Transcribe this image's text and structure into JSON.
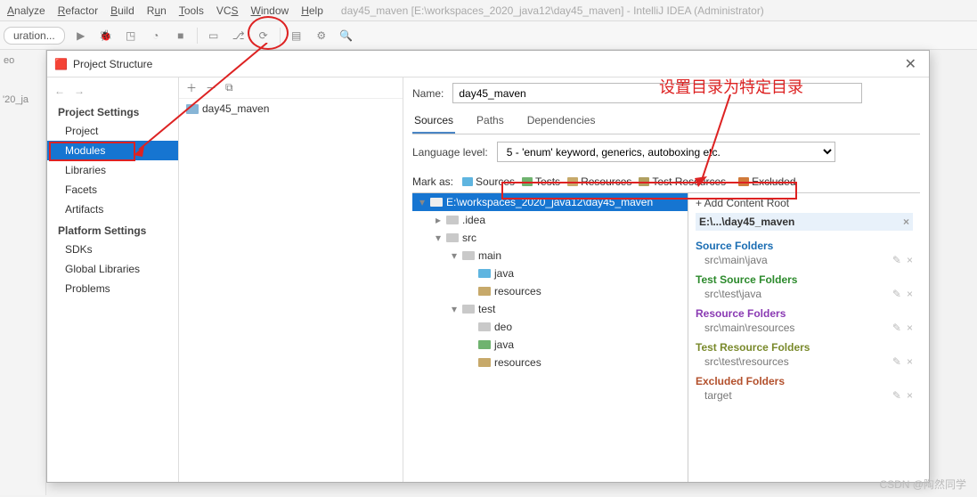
{
  "menubar": {
    "items": [
      "Analyze",
      "Refactor",
      "Build",
      "Run",
      "Tools",
      "VCS",
      "Window",
      "Help"
    ],
    "title": "day45_maven [E:\\workspaces_2020_java12\\day45_maven] - IntelliJ IDEA (Administrator)"
  },
  "toolbar": {
    "config": "uration..."
  },
  "sidebar": {
    "tab": "eo",
    "crumb": "'20_ja"
  },
  "dialog": {
    "title": "Project Structure",
    "nav": {
      "sections": [
        {
          "header": "Project Settings",
          "items": [
            "Project",
            "Modules",
            "Libraries",
            "Facets",
            "Artifacts"
          ],
          "selected": "Modules"
        },
        {
          "header": "Platform Settings",
          "items": [
            "SDKs",
            "Global Libraries"
          ]
        },
        {
          "header": "",
          "items": [
            "Problems"
          ]
        }
      ]
    },
    "module": "day45_maven",
    "right": {
      "nameLabel": "Name:",
      "nameValue": "day45_maven",
      "tabs": [
        "Sources",
        "Paths",
        "Dependencies"
      ],
      "activeTab": "Sources",
      "langLabel": "Language level:",
      "langValue": "5 - 'enum' keyword, generics, autoboxing etc.",
      "markLabel": "Mark as:",
      "marks": [
        "Sources",
        "Tests",
        "Resources",
        "Test Resources",
        "Excluded"
      ],
      "treeRoot": "E:\\workspaces_2020_java12\\day45_maven",
      "tree": [
        {
          "d": 1,
          "t": "tw",
          "l": ".idea",
          "c": "fld"
        },
        {
          "d": 1,
          "t": "tw-open",
          "l": "src",
          "c": "fld"
        },
        {
          "d": 2,
          "t": "tw-open",
          "l": "main",
          "c": "fld"
        },
        {
          "d": 3,
          "t": "leaf",
          "l": "java",
          "c": "fld blue"
        },
        {
          "d": 3,
          "t": "leaf",
          "l": "resources",
          "c": "fld yel"
        },
        {
          "d": 2,
          "t": "tw-open",
          "l": "test",
          "c": "fld"
        },
        {
          "d": 3,
          "t": "leaf",
          "l": "deo",
          "c": "fld"
        },
        {
          "d": 3,
          "t": "leaf",
          "l": "java",
          "c": "fld green"
        },
        {
          "d": 3,
          "t": "leaf",
          "l": "resources",
          "c": "fld yel"
        }
      ],
      "addRoot": "+ Add Content Root",
      "rootPath": "E:\\...\\day45_maven",
      "folders": [
        {
          "head": "Source Folders",
          "cls": "src",
          "items": [
            "src\\main\\java"
          ]
        },
        {
          "head": "Test Source Folders",
          "cls": "tst",
          "items": [
            "src\\test\\java"
          ]
        },
        {
          "head": "Resource Folders",
          "cls": "res",
          "items": [
            "src\\main\\resources"
          ]
        },
        {
          "head": "Test Resource Folders",
          "cls": "tres",
          "items": [
            "src\\test\\resources"
          ]
        },
        {
          "head": "Excluded Folders",
          "cls": "exc",
          "items": [
            "target"
          ]
        }
      ]
    }
  },
  "annotation": "设置目录为特定目录",
  "watermark": "CSDN @陶然同学"
}
